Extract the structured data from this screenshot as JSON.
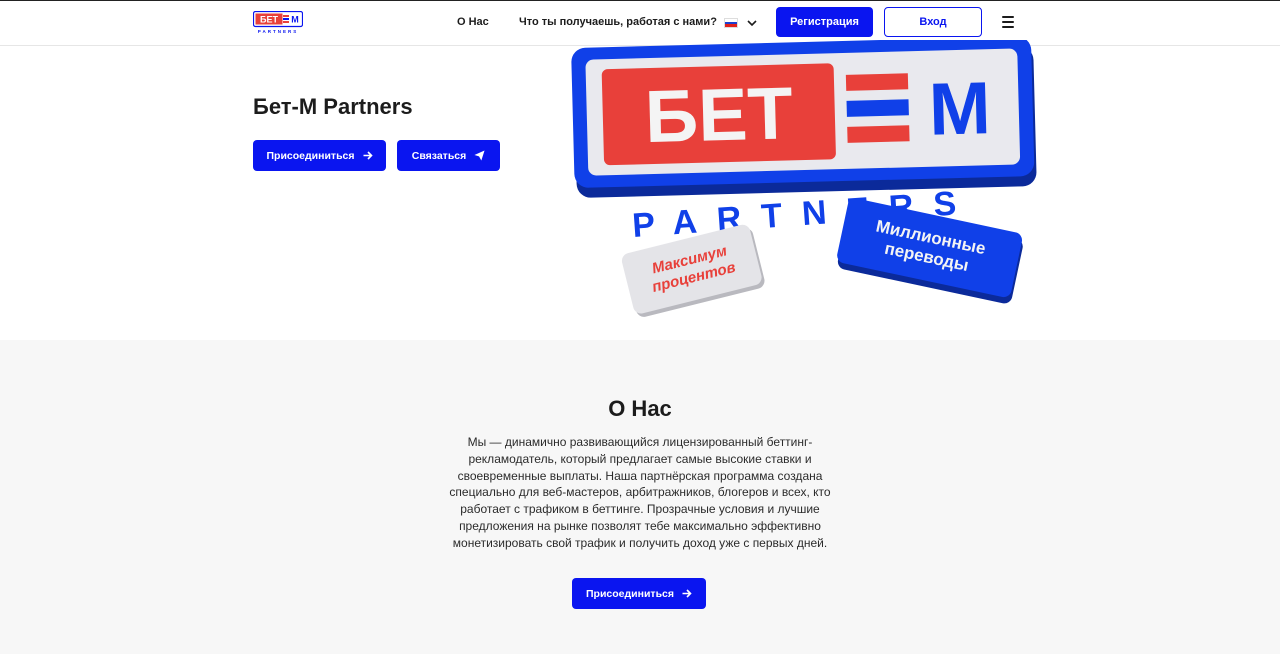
{
  "header": {
    "logo_text": "БЕТ=М",
    "logo_subtext": "PARTNERS",
    "nav": [
      {
        "label": "О Нас"
      },
      {
        "label": "Что ты получаешь, работая с нами?"
      }
    ],
    "language_icon": "russia-flag-icon",
    "register_label": "Регистрация",
    "login_label": "Вход",
    "menu_icon": "hamburger-menu-icon"
  },
  "hero": {
    "title": "Бет-М Partners",
    "join_label": "Присоединиться",
    "contact_label": "Связаться",
    "art": {
      "brand": "БЕТ=М",
      "partners": "PARTNERS",
      "badge_left_line1": "Максимум",
      "badge_left_line2": "процентов",
      "badge_right_line1": "Миллионные",
      "badge_right_line2": "переводы"
    }
  },
  "about": {
    "title": "О Нас",
    "text": "Мы — динамично развивающийся лицензированный беттинг-рекламодатель, который предлагает самые высокие ставки и своевременные выплаты. Наша партнёрская программа создана специально для веб-мастеров, арбитражников, блогеров и всех, кто работает с трафиком в беттинге. Прозрачные условия и лучшие предложения на рынке позволят тебе максимально эффективно монетизировать свой трафик и получить доход уже с первых дней.",
    "join_label": "Присоединиться"
  },
  "colors": {
    "brand_blue": "#0a15f0",
    "brand_red": "#e8403a",
    "background_gray": "#f7f7f7"
  }
}
